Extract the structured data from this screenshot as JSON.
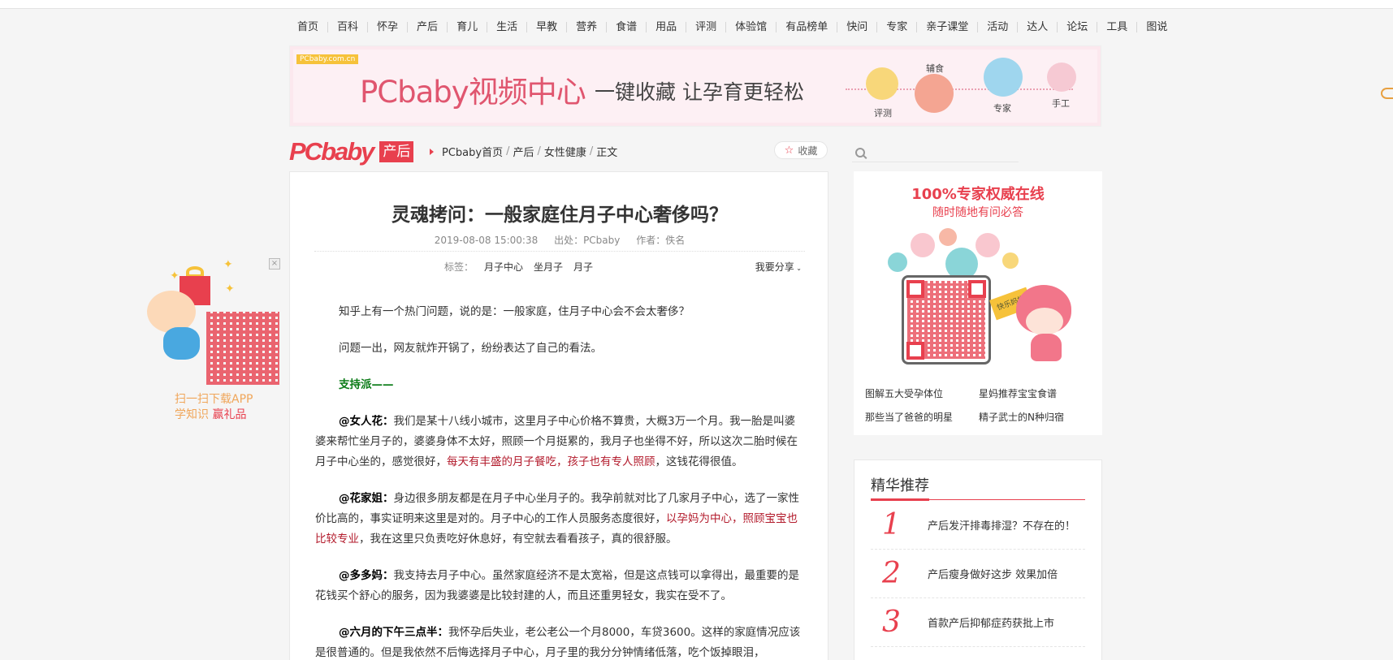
{
  "nav": [
    "首页",
    "百科",
    "怀孕",
    "产后",
    "育儿",
    "生活",
    "早教",
    "营养",
    "食谱",
    "用品",
    "评测",
    "体验馆",
    "有品榜单",
    "快问",
    "专家",
    "亲子课堂",
    "活动",
    "达人",
    "论坛",
    "工具",
    "图说"
  ],
  "banner": {
    "url": "PCbaby.com.cn",
    "title": "PCbaby视频中心",
    "subtitle": "一键收藏 让孕育更轻松",
    "bubbles": [
      "评测",
      "辅食",
      "专家",
      "手工"
    ]
  },
  "logo": {
    "text": "PCbaby",
    "tag": "产后"
  },
  "breadcrumb": [
    "PCbaby首页",
    "产后",
    "女性健康",
    "正文"
  ],
  "favorite_label": "收藏",
  "article": {
    "title": "灵魂拷问：一般家庭住月子中心奢侈吗？",
    "date": "2019-08-08 15:00:38",
    "source": "出处：PCbaby",
    "author": "作者：佚名",
    "tags_label": "标签：",
    "tags": [
      "月子中心",
      "坐月子",
      "月子"
    ],
    "share": "我要分享",
    "p1": "知乎上有一个热门问题，说的是：一般家庭，住月子中心会不会太奢侈？",
    "p2": "问题一出，网友就炸开锅了，纷纷表达了自己的看法。",
    "p3": "支持派——",
    "p4_name": "@女人花：",
    "p4_a": "我们是某十八线小城市，这里月子中心价格不算贵，大概3万一个月。我一胎是叫婆婆来帮忙坐月子的，婆婆身体不太好，照顾一个月挺累的，我月子也坐得不好，所以这次二胎时候在月子中心坐的，感觉很好，",
    "p4_red": "每天有丰盛的月子餐吃，孩子也有专人照顾",
    "p4_b": "，这钱花得很值。",
    "p5_name": "@花家姐：",
    "p5_a": "身边很多朋友都是在月子中心坐月子的。我孕前就对比了几家月子中心，选了一家性价比高的，事实证明来这里是对的。月子中心的工作人员服务态度很好，",
    "p5_red": "以孕妈为中心，照顾宝宝也比较专业",
    "p5_b": "，我在这里只负责吃好休息好，有空就去看看孩子，真的很舒服。",
    "p6_name": "@多多妈：",
    "p6_a": "我支持去月子中心。虽然家庭经济不是太宽裕，但是这点钱可以拿得出，最重要的是花钱买个舒心的服务，因为我婆婆是比较封建的人，而且还重男轻女，我实在受不了。",
    "p7_name": "@六月的下午三点半：",
    "p7_a": "我怀孕后失业，老公老公一个月8000，车贷3600。这样的家庭情况应该是很普通的。但是我依然不后悔选择月子中心，月子里的我分分钟情绪低落，吃个饭掉眼泪，"
  },
  "search": {
    "placeholder": ""
  },
  "ad": {
    "headline": "100%专家权威在线",
    "sub": "随时随地有问必答",
    "sign": "快乐妈妈",
    "links": [
      "图解五大受孕体位",
      "星妈推荐宝宝食谱",
      "那些当了爸爸的明星",
      "精子武士的N种归宿"
    ]
  },
  "recommend": {
    "title": "精华推荐",
    "items": [
      {
        "num": "1",
        "text": "产后发汗排毒排湿？不存在的！"
      },
      {
        "num": "2",
        "text": "产后瘦身做好这步 效果加倍"
      },
      {
        "num": "3",
        "text": "首款产后抑郁症药获批上市"
      }
    ]
  },
  "float_ad": {
    "line1": "扫一扫下载APP",
    "line2a": "学知识 ",
    "line2b": "赢礼品",
    "close": "×"
  },
  "colors": {
    "brand": "#e8404e",
    "green": "#0a7b16",
    "red_text": "#b31b2c"
  }
}
